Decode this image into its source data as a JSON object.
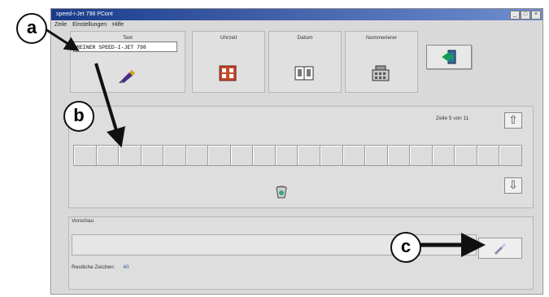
{
  "window": {
    "title": "speed-i-Jet 798 PCont"
  },
  "menu": {
    "items": [
      "Zeile",
      "Einstellungen",
      "Hilfe"
    ]
  },
  "toolbar": {
    "text_label": "Text",
    "text_value": "REINER SPEED-I-JET 798",
    "uhrzeit_label": "Uhrzeit",
    "datum_label": "Datum",
    "nummerierer_label": "Nummerierer"
  },
  "line_info": "Zeile 5 von 11",
  "preview": {
    "label": "Vorschau",
    "count_label": "Restliche Zeichen:",
    "count_value": "40"
  },
  "callouts": {
    "a": "a",
    "b": "b",
    "c": "c"
  },
  "icons": {
    "pen": "pen-icon",
    "clock": "calendar-grid-icon",
    "date": "calendar-book-icon",
    "counter": "numbering-stamp-icon",
    "exit": "exit-door-icon",
    "up": "arrow-up-icon",
    "down": "arrow-down-icon",
    "trash": "trash-icon",
    "send": "send-icon"
  }
}
